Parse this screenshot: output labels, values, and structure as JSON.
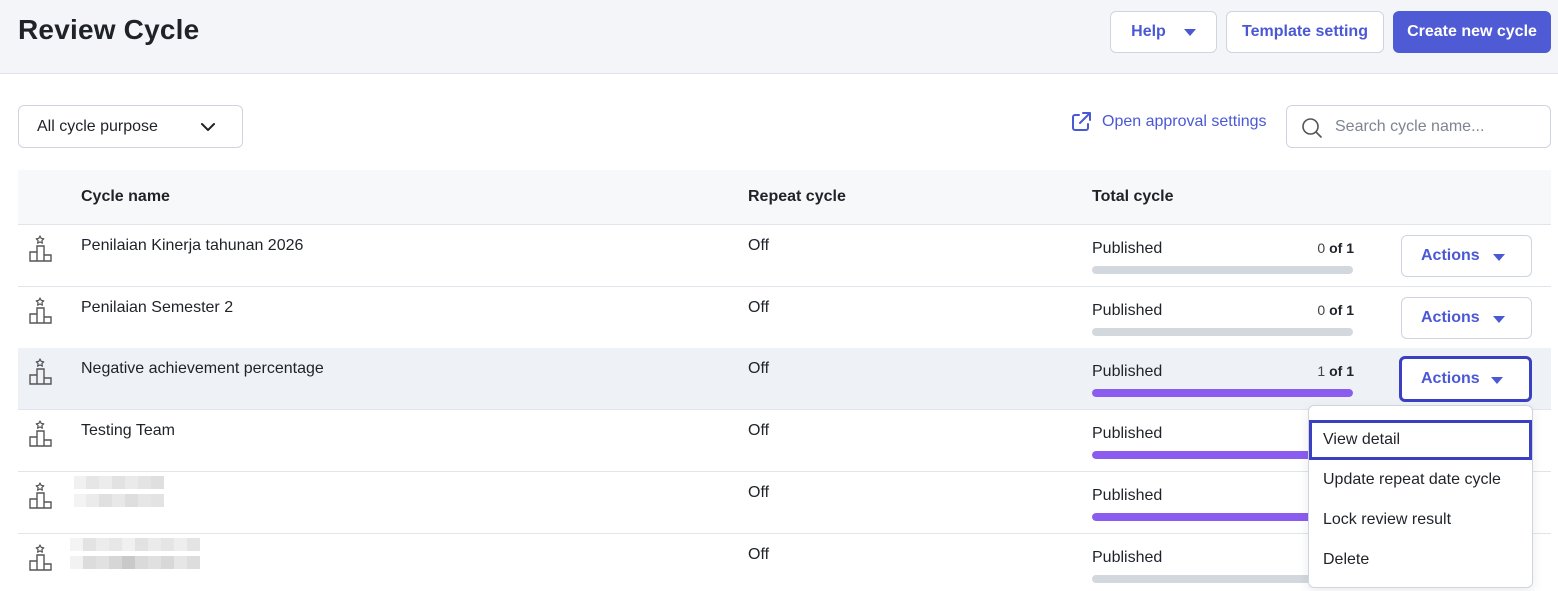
{
  "header": {
    "title": "Review Cycle",
    "help_label": "Help",
    "template_label": "Template setting",
    "create_label": "Create new cycle"
  },
  "toolbar": {
    "filter_value": "All cycle purpose",
    "approval_label": "Open approval settings",
    "search_placeholder": "Search cycle name..."
  },
  "table": {
    "columns": [
      "Cycle name",
      "Repeat cycle",
      "Total cycle"
    ],
    "action_label": "Actions",
    "rows": [
      {
        "name": "Penilaian Kinerja tahunan 2026",
        "repeat": "Off",
        "status": "Published",
        "done": "0",
        "of": "of",
        "total": "1",
        "progress": 0
      },
      {
        "name": "Penilaian Semester 2",
        "repeat": "Off",
        "status": "Published",
        "done": "0",
        "of": "of",
        "total": "1",
        "progress": 0
      },
      {
        "name": "Negative achievement percentage",
        "repeat": "Off",
        "status": "Published",
        "done": "1",
        "of": "of",
        "total": "1",
        "progress": 1
      },
      {
        "name": "Testing Team",
        "repeat": "Off",
        "status": "Published",
        "progress": 1
      },
      {
        "name": "",
        "repeat": "Off",
        "status": "Published",
        "progress": 1
      },
      {
        "name": "",
        "repeat": "Off",
        "status": "Published",
        "progress": 0
      }
    ]
  },
  "menu": {
    "items": [
      "View detail",
      "Update repeat date cycle",
      "Lock review result",
      "Delete"
    ]
  },
  "colors": {
    "accent": "#4f5bd5",
    "progress": "#8a5cf0",
    "focus_ring": "#3b3fc2"
  }
}
